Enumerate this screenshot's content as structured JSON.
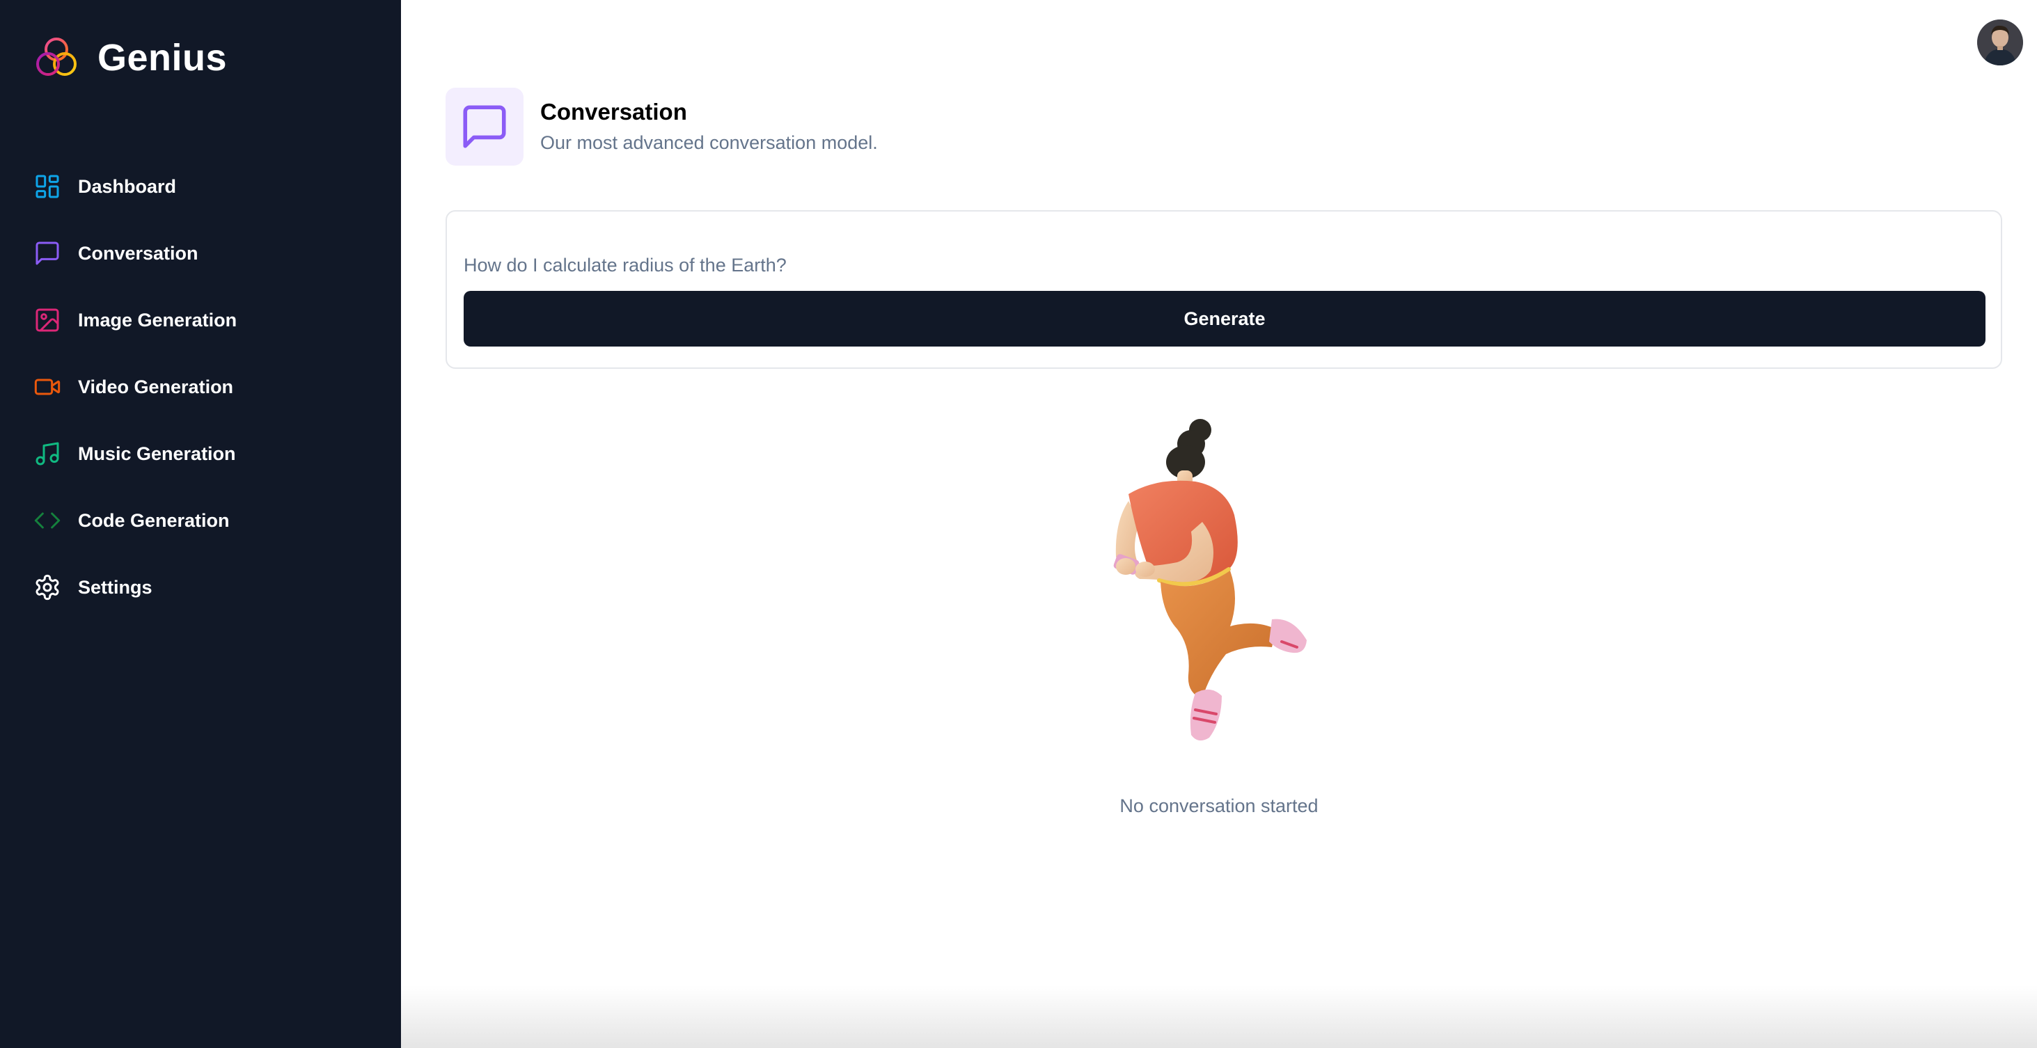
{
  "brand": {
    "name": "Genius"
  },
  "sidebar": {
    "items": [
      {
        "label": "Dashboard",
        "icon": "layout-dashboard-icon",
        "color": "#0ea5e9"
      },
      {
        "label": "Conversation",
        "icon": "message-square-icon",
        "color": "#8b5cf6"
      },
      {
        "label": "Image Generation",
        "icon": "image-icon",
        "color": "#db2777"
      },
      {
        "label": "Video Generation",
        "icon": "video-icon",
        "color": "#ea580c"
      },
      {
        "label": "Music Generation",
        "icon": "music-icon",
        "color": "#10b981"
      },
      {
        "label": "Code Generation",
        "icon": "code-icon",
        "color": "#15803d"
      },
      {
        "label": "Settings",
        "icon": "settings-icon",
        "color": "#ffffff"
      }
    ]
  },
  "page": {
    "title": "Conversation",
    "description": "Our most advanced conversation model.",
    "icon": "message-square-icon",
    "accent": "#8b5cf6"
  },
  "prompt": {
    "placeholder": "How do I calculate radius of the Earth?",
    "value": "",
    "button_label": "Generate"
  },
  "empty_state": {
    "text": "No conversation started"
  },
  "colors": {
    "sidebar_bg": "#111827",
    "button_bg": "#111827",
    "muted_text": "#64748b"
  }
}
